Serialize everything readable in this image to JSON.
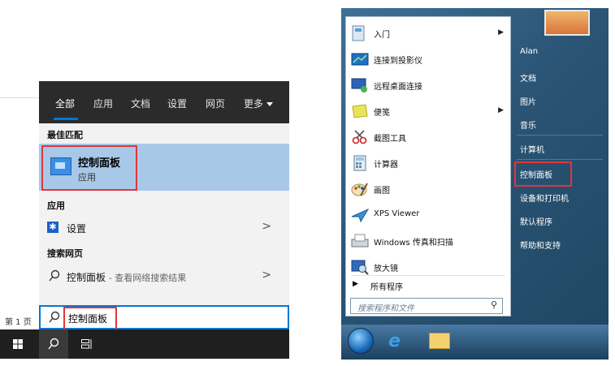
{
  "win10": {
    "tabs": [
      "全部",
      "应用",
      "文档",
      "设置",
      "网页",
      "更多"
    ],
    "best_match_header": "最佳匹配",
    "best_match": {
      "title": "控制面板",
      "subtitle": "应用"
    },
    "apps_header": "应用",
    "apps": [
      {
        "label": "设置"
      }
    ],
    "web_header": "搜索网页",
    "web": {
      "query": "控制面板",
      "suffix": "- 查看网络搜索结果"
    },
    "search_value": "控制面板",
    "doc_status": "第 1 页",
    "chevron": ">"
  },
  "win7": {
    "left_items": [
      {
        "label": "入门",
        "icon": "getting-started-icon",
        "arrow": true
      },
      {
        "label": "连接到投影仪",
        "icon": "projector-icon",
        "arrow": false
      },
      {
        "label": "远程桌面连接",
        "icon": "remote-desktop-icon",
        "arrow": false
      },
      {
        "label": "便笺",
        "icon": "sticky-notes-icon",
        "arrow": true
      },
      {
        "label": "截图工具",
        "icon": "snipping-tool-icon",
        "arrow": false
      },
      {
        "label": "计算器",
        "icon": "calculator-icon",
        "arrow": false
      },
      {
        "label": "画图",
        "icon": "paint-icon",
        "arrow": false
      },
      {
        "label": "XPS Viewer",
        "icon": "xps-viewer-icon",
        "arrow": false
      },
      {
        "label": "Windows 传真和扫描",
        "icon": "fax-scan-icon",
        "arrow": false
      },
      {
        "label": "放大镜",
        "icon": "magnifier-icon",
        "arrow": false
      }
    ],
    "all_programs": "所有程序",
    "search_placeholder": "搜索程序和文件",
    "right_items": [
      "Alan",
      "文档",
      "图片",
      "音乐",
      "计算机",
      "控制面板",
      "设备和打印机",
      "默认程序",
      "帮助和支持"
    ],
    "highlight_color": "#e0363b",
    "accent": "#0078d7"
  }
}
